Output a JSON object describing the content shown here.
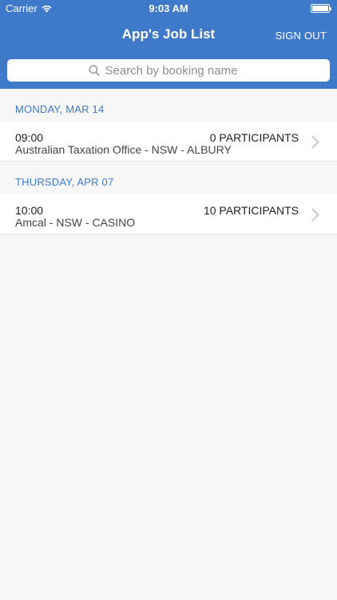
{
  "status_bar": {
    "carrier": "Carrier",
    "time": "9:03 AM"
  },
  "nav": {
    "title": "App's Job List",
    "sign_out": "SIGN OUT"
  },
  "search": {
    "placeholder": "Search by booking name",
    "value": ""
  },
  "sections": [
    {
      "header": "MONDAY, MAR 14",
      "items": [
        {
          "time": "09:00",
          "name": "Australian Taxation Office - NSW - ALBURY",
          "participants": "0 PARTICIPANTS"
        }
      ]
    },
    {
      "header": "THURSDAY, APR 07",
      "items": [
        {
          "time": "10:00",
          "name": "Amcal - NSW - CASINO",
          "participants": "10 PARTICIPANTS"
        }
      ]
    }
  ],
  "colors": {
    "accent": "#3f79c9",
    "background": "#f7f7f7"
  },
  "icons": [
    "wifi-icon",
    "battery-icon",
    "search-icon",
    "chevron-right-icon"
  ]
}
